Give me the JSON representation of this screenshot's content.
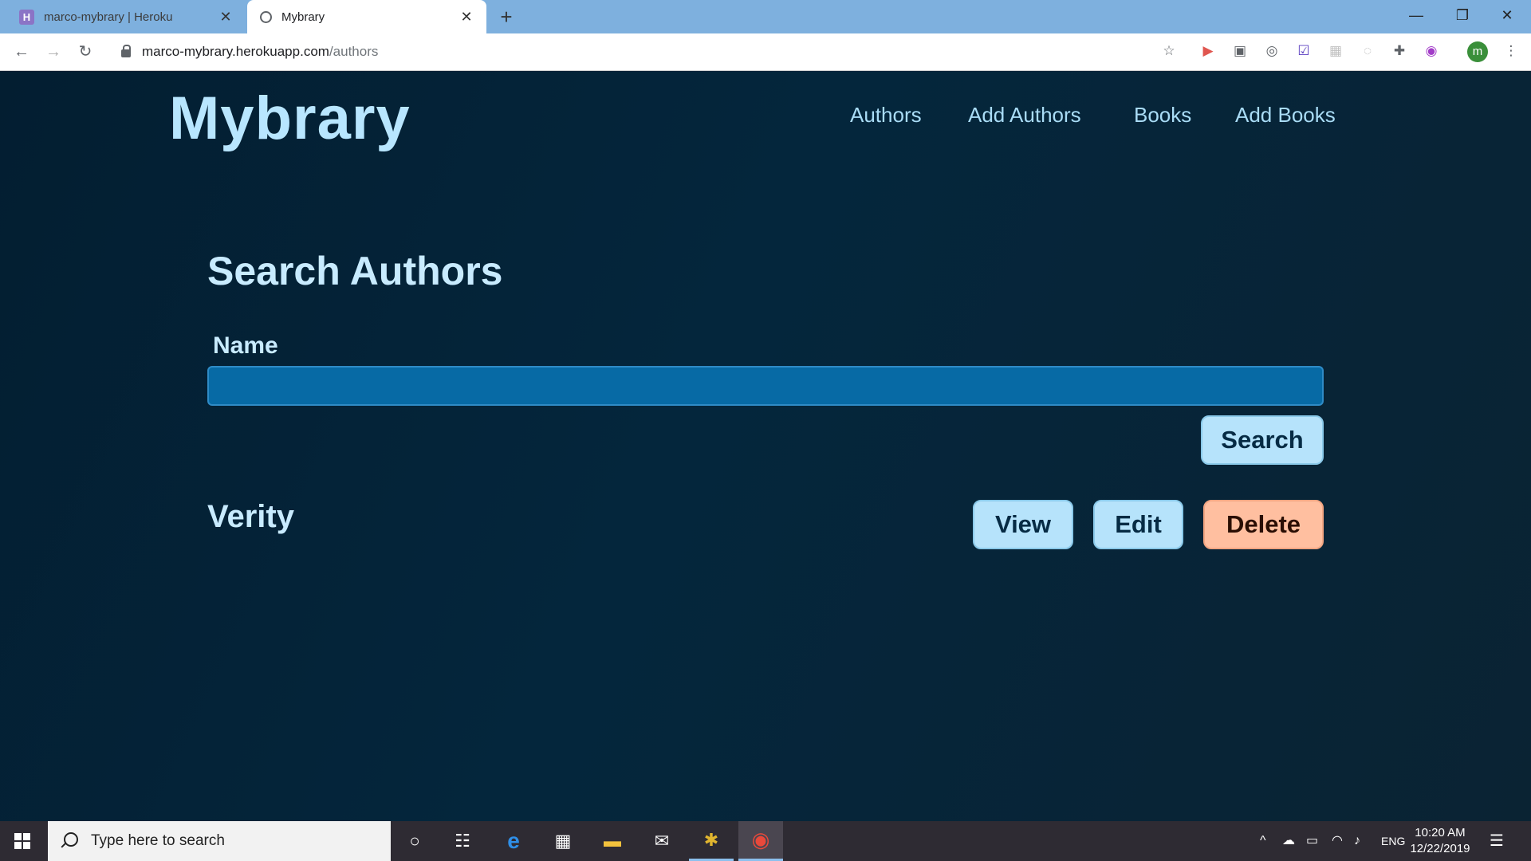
{
  "browser": {
    "tabs": [
      {
        "title": "marco-mybrary | Heroku",
        "favicon": "heroku-icon",
        "active": false
      },
      {
        "title": "Mybrary",
        "favicon": "globe-icon",
        "active": true
      }
    ],
    "new_tab_icon": "plus-icon",
    "window_controls": {
      "minimize": "—",
      "restore": "❐",
      "close": "✕"
    },
    "url": {
      "host": "marco-mybrary.herokuapp.com",
      "path": "/authors"
    },
    "profile_initial": "m"
  },
  "site": {
    "logo": "Mybrary",
    "nav": [
      "Authors",
      "Add Authors",
      "Books",
      "Add Books"
    ]
  },
  "search": {
    "heading": "Search Authors",
    "name_label": "Name",
    "name_value": "",
    "button_label": "Search"
  },
  "authors": [
    {
      "name": "Verity",
      "view_label": "View",
      "edit_label": "Edit",
      "delete_label": "Delete"
    }
  ],
  "colors": {
    "background": "#04263c",
    "accent_light_blue": "#b6e3fb",
    "delete_orange": "#ffbfa0",
    "input_blue": "#076aa5"
  },
  "taskbar": {
    "search_placeholder": "Type here to search",
    "language": "ENG",
    "time": "10:20 AM",
    "date": "12/22/2019"
  }
}
